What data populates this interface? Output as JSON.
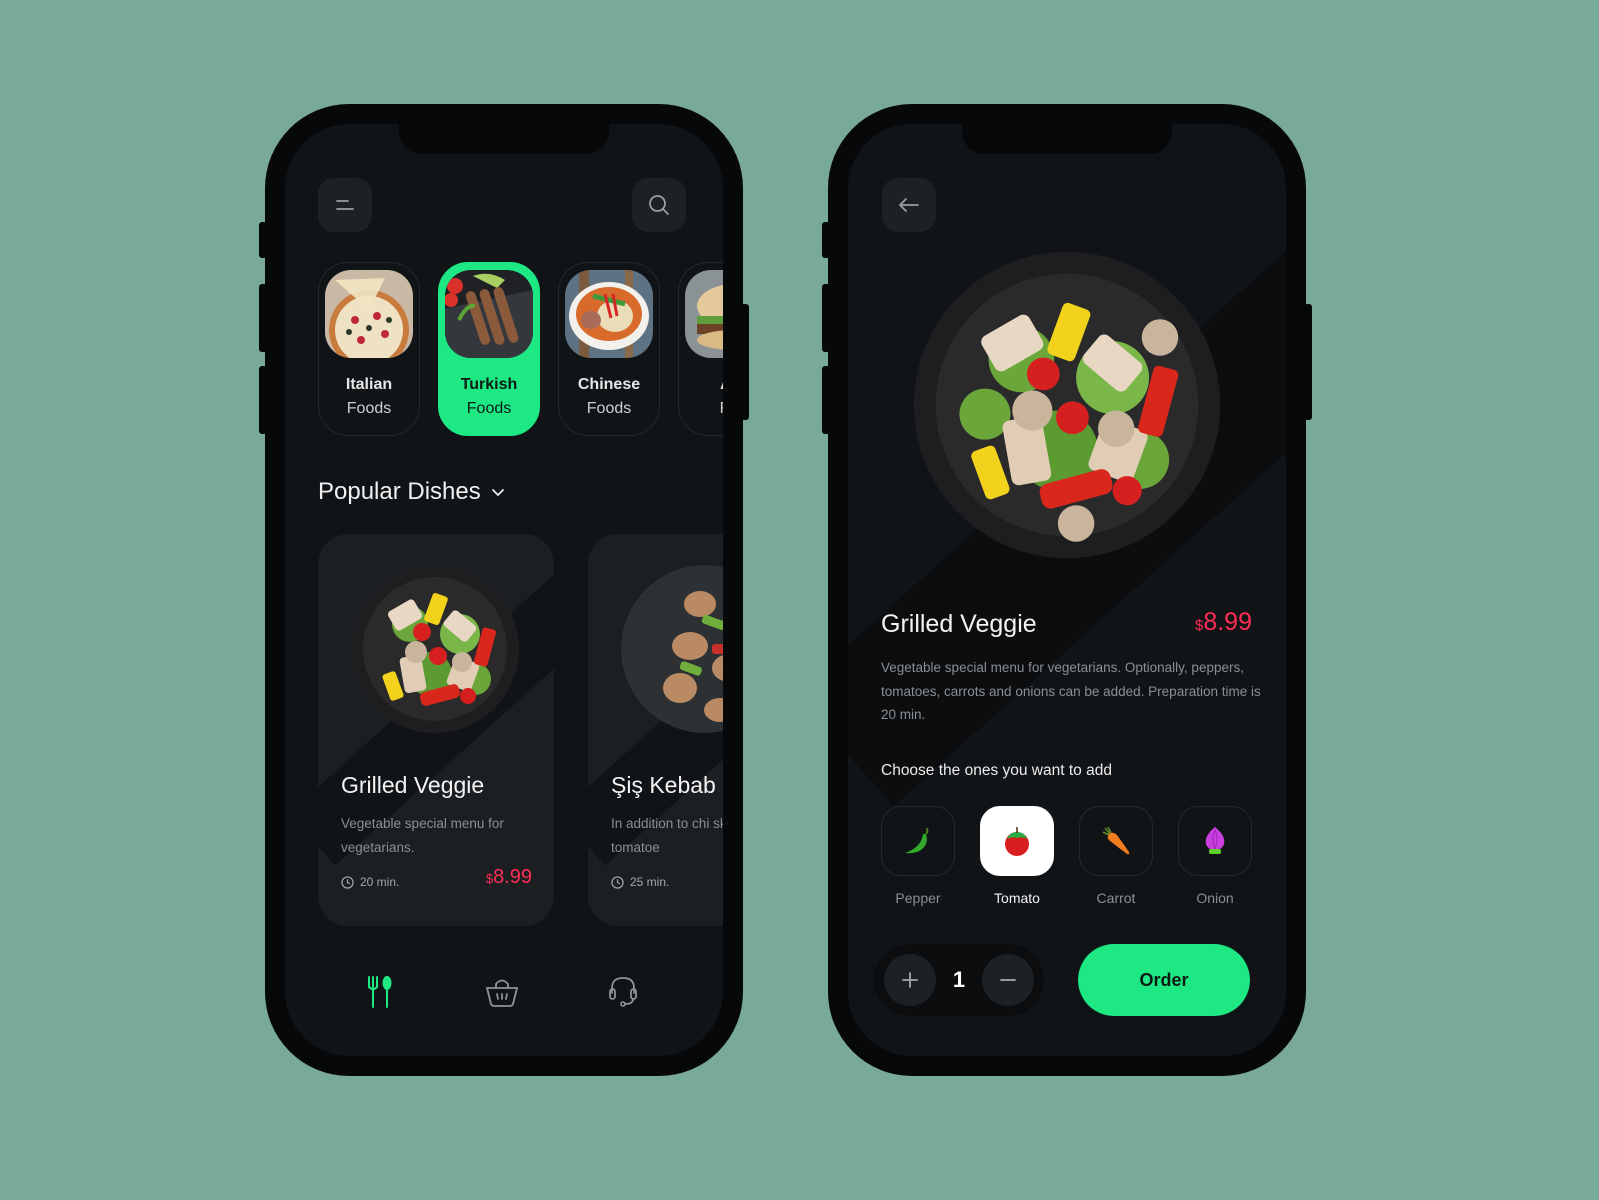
{
  "colors": {
    "background": "#78a99a",
    "accent_green": "#1de884",
    "price_red": "#ff2c55",
    "screen_bg": "#111417"
  },
  "home": {
    "menu_icon": "menu-icon",
    "search_icon": "search-icon",
    "categories": [
      {
        "line1": "Italian",
        "line2": "Foods",
        "image": "pizza",
        "active": false
      },
      {
        "line1": "Turkish",
        "line2": "Foods",
        "image": "kebab-skewers",
        "active": true
      },
      {
        "line1": "Chinese",
        "line2": "Foods",
        "image": "noodle-bowl",
        "active": false
      },
      {
        "line1": "Ar",
        "line2": "Fa",
        "image": "burger",
        "active": false
      }
    ],
    "section_title": "Popular Dishes",
    "dishes": [
      {
        "name": "Grilled Veggie",
        "description": "Vegetable special menu for vegetarians.",
        "time": "20 min.",
        "currency": "$",
        "price": "8.99"
      },
      {
        "name": "Şiş Kebab",
        "description": "In addition to chi skewers, tomatoe",
        "time": "25 min."
      }
    ],
    "bottom_nav": [
      {
        "icon": "fork-spoon-icon",
        "active": true
      },
      {
        "icon": "basket-icon",
        "active": false
      },
      {
        "icon": "headset-icon",
        "active": false
      }
    ]
  },
  "detail": {
    "back_icon": "back-arrow-icon",
    "title": "Grilled Veggie",
    "currency": "$",
    "price": "8.99",
    "description": "Vegetable special menu for vegetarians. Optionally, peppers, tomatoes, carrots and onions can be added. Preparation time is 20 min.",
    "choose_title": "Choose the ones you want to add",
    "ingredients": [
      {
        "label": "Pepper",
        "icon": "pepper-icon",
        "selected": false
      },
      {
        "label": "Tomato",
        "icon": "tomato-icon",
        "selected": true
      },
      {
        "label": "Carrot",
        "icon": "carrot-icon",
        "selected": false
      },
      {
        "label": "Onion",
        "icon": "onion-icon",
        "selected": false
      }
    ],
    "quantity": "1",
    "order_label": "Order"
  }
}
